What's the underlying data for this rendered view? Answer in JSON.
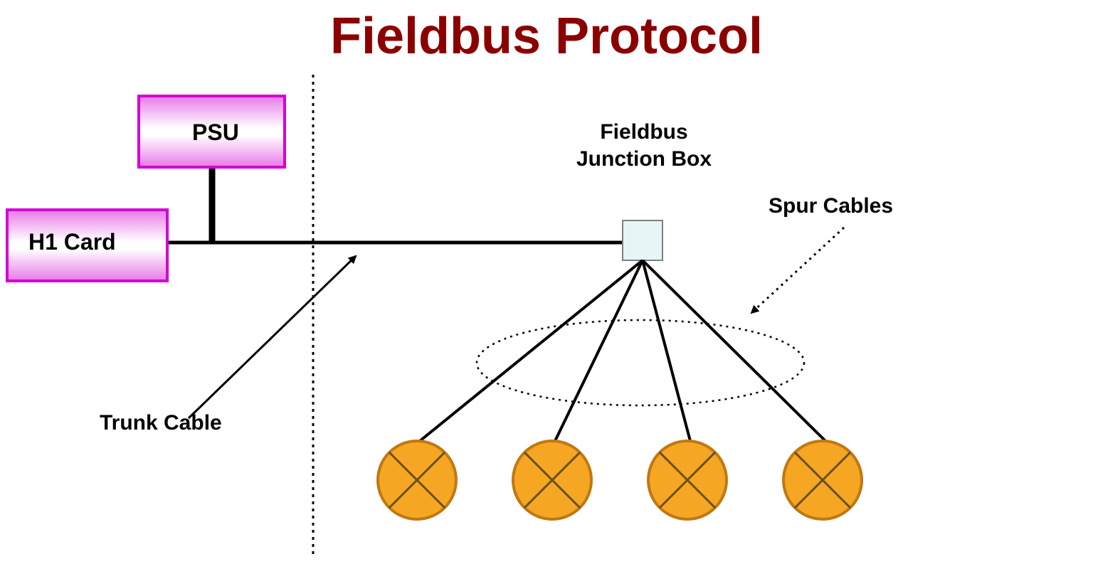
{
  "title": "Fieldbus Protocol",
  "components": {
    "psu": {
      "label": "PSU"
    },
    "h1_card": {
      "label": "H1 Card"
    },
    "junction_box": {
      "label_line1": "Fieldbus",
      "label_line2": "Junction Box"
    },
    "trunk_cable": {
      "label": "Trunk Cable"
    },
    "spur_cables": {
      "label": "Spur Cables"
    }
  },
  "colors": {
    "title": "#8B0000",
    "box_border": "#D400D4",
    "box_gradient_top": "#E879E8",
    "box_gradient_mid": "#FFFFFF",
    "junction_fill": "#E0F2F2",
    "device_fill": "#F5A623",
    "device_stroke": "#C07812"
  },
  "devices": {
    "count": 4
  }
}
